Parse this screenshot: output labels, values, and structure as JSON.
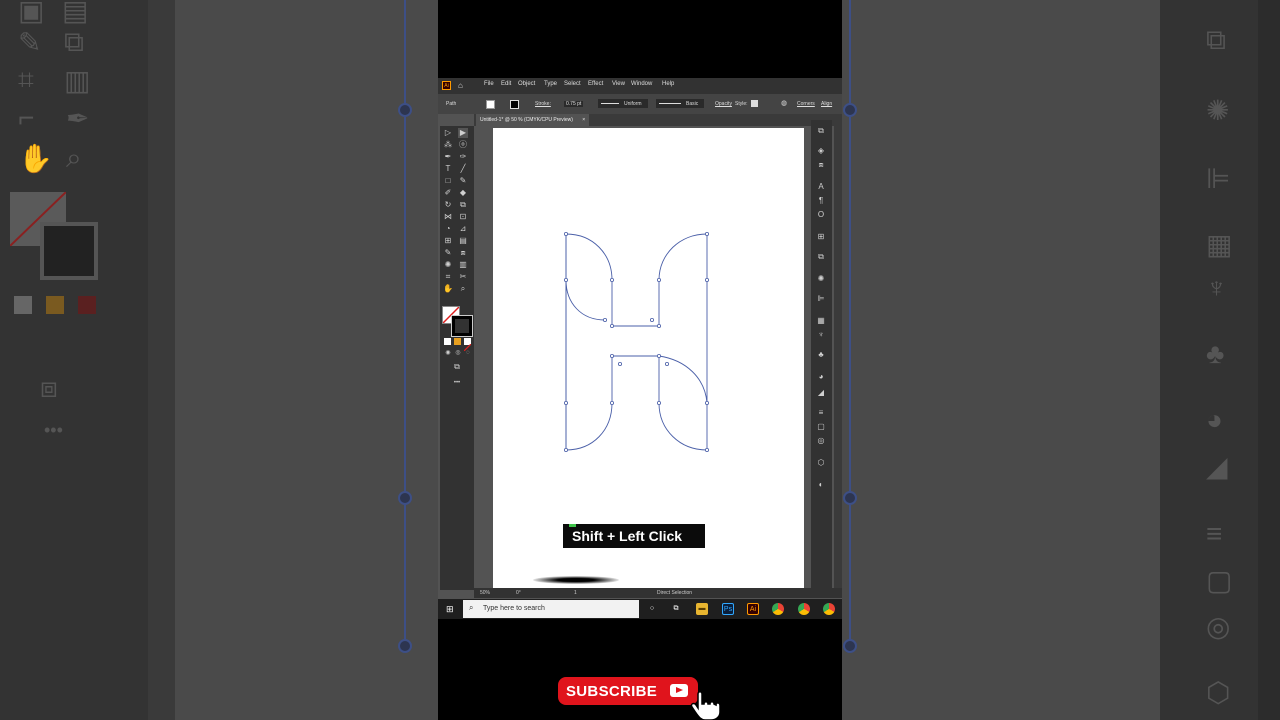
{
  "menu": [
    "File",
    "Edit",
    "Object",
    "Type",
    "Select",
    "Effect",
    "View",
    "Window",
    "Help"
  ],
  "control_bar": {
    "selection_label": "Path",
    "stroke_label": "Stroke:",
    "stroke_weight": "0.75 pt",
    "profile": "Uniform",
    "brush": "Basic",
    "opacity_label": "Opacity",
    "style_label": "Style:",
    "corners": "Corners",
    "align": "Align"
  },
  "document_tab": {
    "title": "Untitled-1* @ 50 % (CMYK/CPU Preview)",
    "close": "×"
  },
  "status_bar": {
    "zoom": "50%",
    "rotation": "0°",
    "artboard_number": "1",
    "current_tool": "Direct Selection"
  },
  "taskbar": {
    "search_placeholder": "Type here to search",
    "apps": [
      "task-view",
      "file-explorer",
      "photoshop",
      "illustrator",
      "chrome",
      "chrome-canary",
      "chrome-profile"
    ]
  },
  "overlay_caption": "Shift + Left Click",
  "subscribe_label": "SUBSCRIBE",
  "colors": {
    "path_stroke": "#4a5fa8",
    "subscribe_red": "#e0141c",
    "caption_bg": "#0b0b0b"
  }
}
